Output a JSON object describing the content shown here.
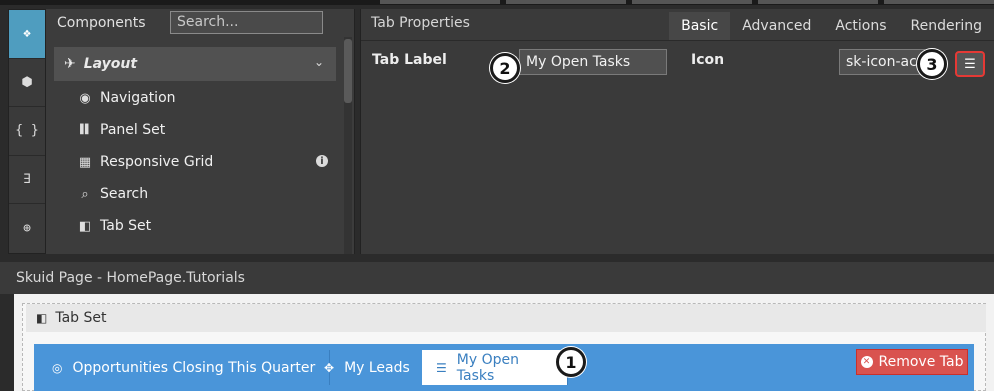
{
  "rail": {
    "items": [
      {
        "icon": "components-cube-icon",
        "glyph": "❖",
        "active": true
      },
      {
        "icon": "model-cube-icon",
        "glyph": "⬢",
        "active": false
      },
      {
        "icon": "javascript-braces-icon",
        "glyph": "{ }",
        "active": false
      },
      {
        "icon": "css3-icon",
        "glyph": "∃",
        "active": false
      },
      {
        "icon": "globe-icon",
        "glyph": "⊕",
        "active": false
      }
    ]
  },
  "components": {
    "title": "Components",
    "search_placeholder": "Search...",
    "group": {
      "label": "Layout",
      "icon": "rocket-icon",
      "chevron": "⌄"
    },
    "items": [
      {
        "label": "Navigation",
        "icon": "compass-icon",
        "glyph": "◉"
      },
      {
        "label": "Panel Set",
        "icon": "panel-set-icon",
        "glyph": "▌▌"
      },
      {
        "label": "Responsive Grid",
        "icon": "grid-icon",
        "glyph": "▦"
      },
      {
        "label": "Search",
        "icon": "search-icon",
        "glyph": "⌕"
      },
      {
        "label": "Tab Set",
        "icon": "tab-set-icon",
        "glyph": "◧"
      }
    ],
    "info_glyph": "i"
  },
  "props": {
    "title": "Tab Properties",
    "tabs": [
      "Basic",
      "Advanced",
      "Actions",
      "Rendering"
    ],
    "active_tab": "Basic",
    "tab_label": {
      "label": "Tab Label",
      "value": "My Open Tasks"
    },
    "icon": {
      "label": "Icon",
      "value": "sk-icon-active"
    },
    "icon_button_glyph": "☰"
  },
  "callouts": [
    "1",
    "2",
    "3"
  ],
  "page": {
    "title": "Skuid Page - HomePage.Tutorials"
  },
  "tabset": {
    "title": "Tab Set",
    "tabs": [
      {
        "label": "Opportunities Closing This Quarter",
        "icon": "target-icon",
        "glyph": "◎",
        "selected": false
      },
      {
        "label": "My Leads",
        "icon": "crosshair-icon",
        "glyph": "✥",
        "selected": false
      },
      {
        "label": "My Open Tasks",
        "icon": "list-icon",
        "glyph": "☰",
        "selected": true
      }
    ],
    "remove_label": "Remove Tab"
  },
  "colors": {
    "accent_blue": "#4a95d9",
    "rail_active": "#4f9dbf",
    "remove_red": "#d9534f",
    "callout_border_red": "#e53935"
  }
}
